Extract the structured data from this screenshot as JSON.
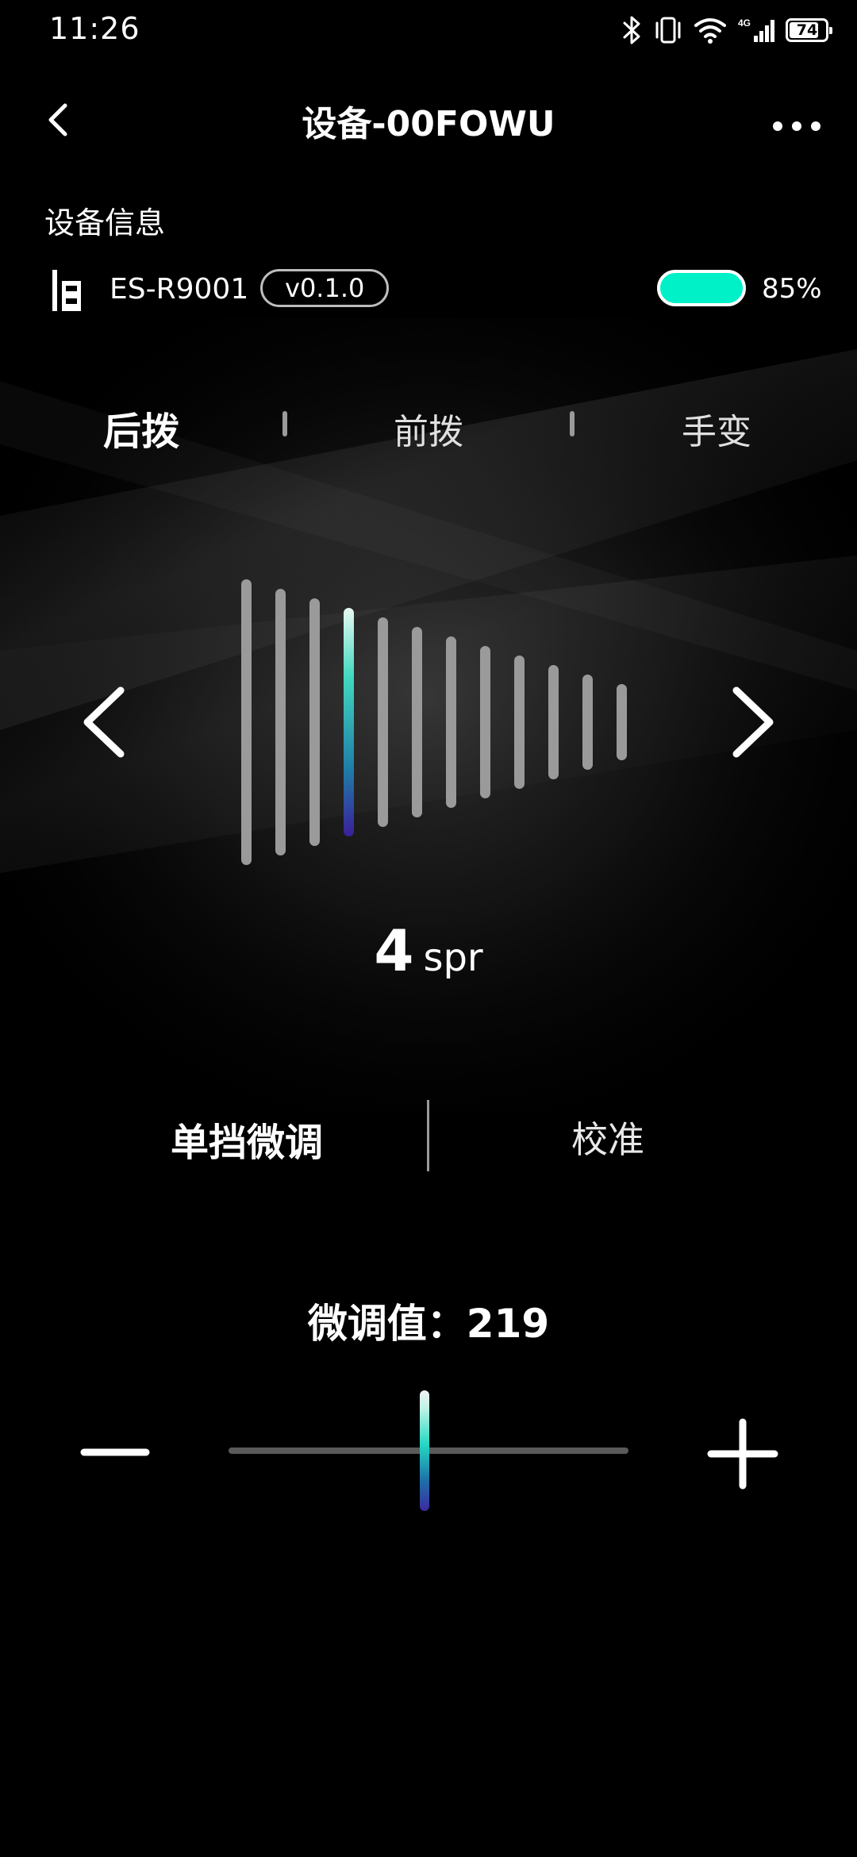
{
  "status_bar": {
    "time": "11:26",
    "network": "4G",
    "battery_level": "74"
  },
  "header": {
    "title": "设备-00FOWU",
    "back_icon": "chevron-left-icon",
    "more_icon": "more-horizontal-icon"
  },
  "device_info": {
    "section_label": "设备信息",
    "model": "ES-R9001",
    "version": "v0.1.0",
    "battery_percent": "85%",
    "battery_color": "#00f0c8"
  },
  "tabs": [
    {
      "label": "后拨",
      "active": true
    },
    {
      "label": "前拨",
      "active": false
    },
    {
      "label": "手变",
      "active": false
    }
  ],
  "gear": {
    "total_gears": 12,
    "selected_gear": 4,
    "value": "4",
    "unit": "spr"
  },
  "mode_switch": {
    "items": [
      {
        "label": "单挡微调",
        "active": true
      },
      {
        "label": "校准",
        "active": false
      }
    ]
  },
  "fine_tune": {
    "label": "微调值：219",
    "slider_fraction": 0.49
  },
  "colors": {
    "accent": "#00f0c8",
    "background": "#000000",
    "inactive_bar": "#9a9a9a"
  }
}
